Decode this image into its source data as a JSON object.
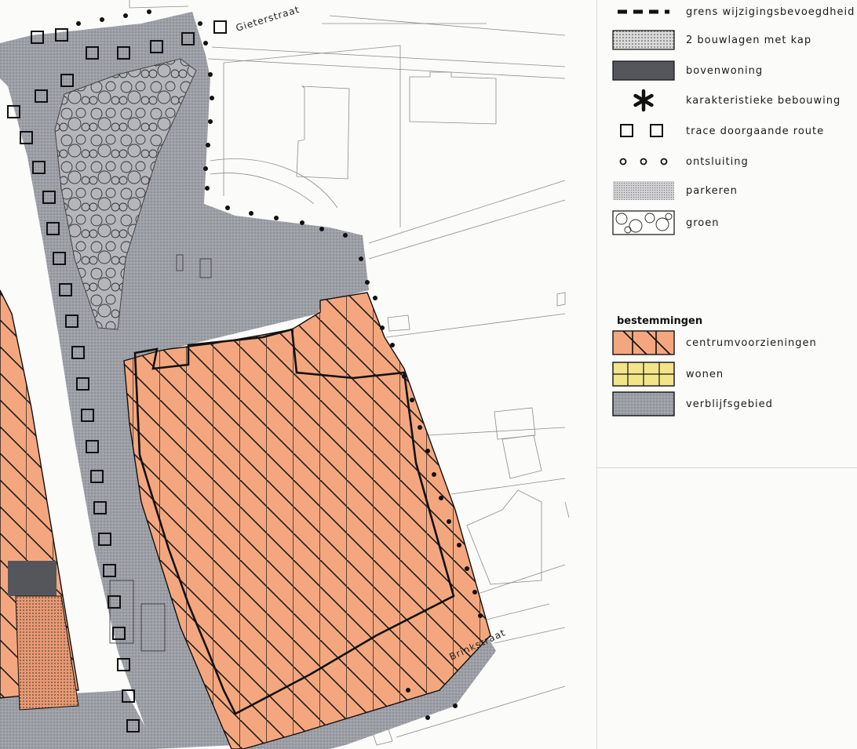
{
  "map": {
    "streets": [
      {
        "name": "Gieterstraat"
      },
      {
        "name": "Brinkstraat"
      }
    ]
  },
  "legend": {
    "items": [
      {
        "id": "grens",
        "label": "grens wijzigingsbevoegdheid",
        "symbol": "dashed-line-icon"
      },
      {
        "id": "bouwlagen",
        "label": "2 bouwlagen met kap",
        "symbol": "dotted-fill-icon"
      },
      {
        "id": "bovenwoning",
        "label": "bovenwoning",
        "symbol": "dark-fill-icon"
      },
      {
        "id": "karakteristiek",
        "label": "karakteristieke bebouwing",
        "symbol": "asterisk-icon"
      },
      {
        "id": "trace",
        "label": "trace doorgaande route",
        "symbol": "square-pair-icon"
      },
      {
        "id": "ontsluiting",
        "label": "ontsluiting",
        "symbol": "circle-row-icon"
      },
      {
        "id": "parkeren",
        "label": "parkeren",
        "symbol": "grid-fill-icon"
      },
      {
        "id": "groen",
        "label": "groen",
        "symbol": "tree-circles-icon"
      }
    ],
    "bestemmingen": {
      "heading": "bestemmingen",
      "items": [
        {
          "id": "centrum",
          "label": "centrumvoorzieningen",
          "symbol": "hatched-orange-icon"
        },
        {
          "id": "wonen",
          "label": "wonen",
          "symbol": "yellow-grid-icon"
        },
        {
          "id": "verblijf",
          "label": "verblijfsgebied",
          "symbol": "gray-fill-icon"
        }
      ]
    }
  },
  "colors": {
    "centrum": "#f4a77e",
    "wonen": "#f3e48a",
    "verblijf": "#9a9ca3",
    "bovenwoning": "#55565c",
    "groen": "#b7b9be"
  }
}
